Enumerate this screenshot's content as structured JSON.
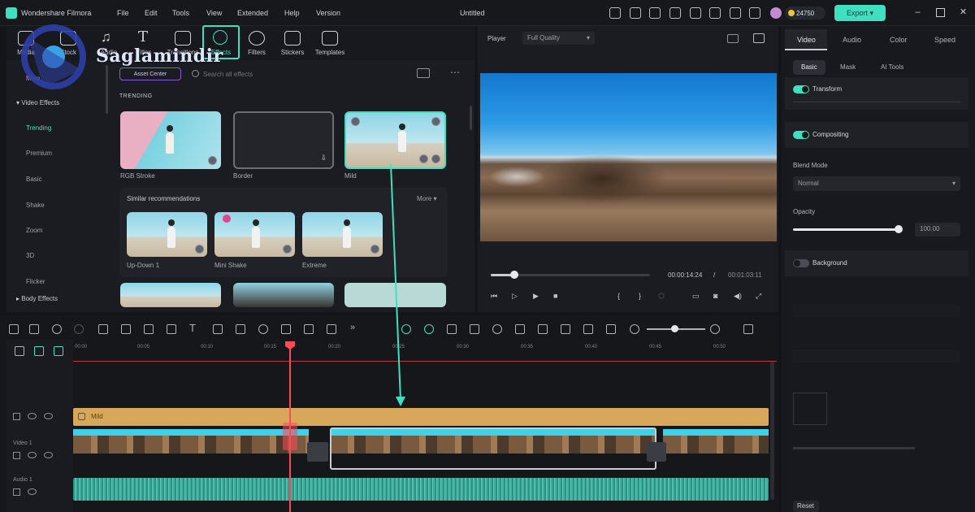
{
  "app": {
    "title": "Wondershare Filmora",
    "menu": [
      "File",
      "Edit",
      "Tools",
      "View",
      "Extended",
      "Help",
      "Version"
    ],
    "project_name": "Untitled",
    "credits": "24750",
    "export_label": "Export"
  },
  "watermark": {
    "text": "Saglamindir"
  },
  "media_toolbar": {
    "items": [
      {
        "label": "Media",
        "icon": "media-icon"
      },
      {
        "label": "Stock",
        "icon": "stock-icon"
      },
      {
        "label": "Audio",
        "icon": "music-note-icon"
      },
      {
        "label": "Titles",
        "icon": "titles-icon"
      },
      {
        "label": "Transitions",
        "icon": "transitions-icon"
      },
      {
        "label": "Effects",
        "icon": "effects-icon"
      },
      {
        "label": "Filters",
        "icon": "filters-icon"
      },
      {
        "label": "Stickers",
        "icon": "stickers-icon"
      },
      {
        "label": "Templates",
        "icon": "templates-icon"
      }
    ]
  },
  "effects_sidebar": {
    "items": [
      "Mine",
      "Video Effects",
      "Trending",
      "Premium",
      "Basic",
      "Shake",
      "Zoom",
      "3D",
      "Flicker",
      "Body Effects"
    ],
    "active": "Trending"
  },
  "effects_panel": {
    "asset_center": "Asset Center",
    "search_placeholder": "Search all effects",
    "section_title": "TRENDING",
    "cards": [
      "RGB Stroke",
      "Border",
      "Mild"
    ],
    "similar_title": "Similar recommendations",
    "more_label": "More",
    "similar_cards": [
      "Up-Down 1",
      "Mini Shake",
      "Extreme"
    ]
  },
  "player": {
    "label": "Player",
    "quality": "Full Quality",
    "current_time": "00:00:14:24",
    "total_time": "00:01:03:11",
    "progress_percent": 15
  },
  "right_panel": {
    "tabs": [
      "Video",
      "Audio",
      "Color",
      "Speed"
    ],
    "active_tab": "Video",
    "subtabs": [
      "Basic",
      "Mask",
      "AI Tools"
    ],
    "active_subtab": "Basic",
    "transform_label": "Transform",
    "compositing_label": "Compositing",
    "blend_mode_label": "Blend Mode",
    "blend_mode_value": "Normal",
    "opacity_label": "Opacity",
    "opacity_value": "100.00",
    "opacity_percent": 100,
    "background_label": "Background",
    "reset_label": "Reset"
  },
  "timeline": {
    "ruler": [
      "00:00",
      "00:05",
      "00:10",
      "00:15",
      "00:20",
      "00:25",
      "00:30",
      "00:35",
      "00:40",
      "00:45",
      "00:50"
    ],
    "effect_clip_label": "Mild",
    "video_track": "Video 1",
    "audio_track": "Audio 1"
  },
  "colors": {
    "accent": "#3fe0c0",
    "playhead": "#ff4a5a",
    "effect_clip": "#d7a85a"
  }
}
